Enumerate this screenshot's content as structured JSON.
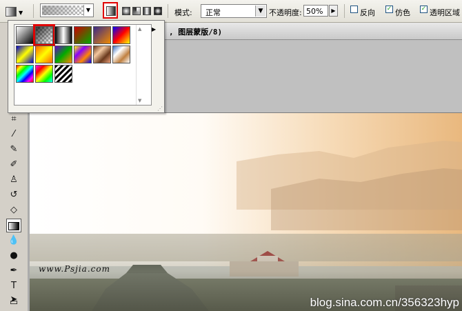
{
  "options_bar": {
    "mode_label": "模式:",
    "mode_value": "正常",
    "opacity_label": "不透明度:",
    "opacity_value": "50%",
    "reverse_label": "反向",
    "reverse_checked": false,
    "dither_label": "仿色",
    "dither_checked": true,
    "transparency_label": "透明区域",
    "transparency_checked": true,
    "gradient_types": [
      "linear-gradient-icon",
      "radial-gradient-icon",
      "angle-gradient-icon",
      "reflected-gradient-icon",
      "diamond-gradient-icon"
    ],
    "selected_gradient_type": "linear-gradient-icon"
  },
  "document": {
    "title_suffix": ", 图层蒙版/8)"
  },
  "watermarks": {
    "site": "www.Psjia.com",
    "blog": "blog.sina.com.cn/356323hyp"
  },
  "gradient_presets": [
    {
      "name": "foreground-to-background",
      "css": "linear-gradient(135deg,#fff,#000)"
    },
    {
      "name": "foreground-to-transparent",
      "css": "checker"
    },
    {
      "name": "black-white",
      "css": "linear-gradient(90deg,#000,#fff,#000)"
    },
    {
      "name": "red-green",
      "css": "linear-gradient(135deg,#c00,#0a0)"
    },
    {
      "name": "violet-orange",
      "css": "linear-gradient(135deg,#3a2a8a,#f08a00)"
    },
    {
      "name": "blue-red-yellow",
      "css": "linear-gradient(135deg,#00f,#f00,#ff0)"
    },
    {
      "name": "blue-yellow-blue",
      "css": "linear-gradient(135deg,#00c,#ff0,#00c)"
    },
    {
      "name": "orange-yellow-orange",
      "css": "linear-gradient(135deg,#f60,#ff0,#f60)"
    },
    {
      "name": "violet-green-orange",
      "css": "linear-gradient(135deg,#60c,#0a0,#f80)"
    },
    {
      "name": "yellow-violet-orange-blue",
      "css": "linear-gradient(135deg,#ff0,#80f,#f80,#00f)"
    },
    {
      "name": "copper",
      "css": "linear-gradient(135deg,#6b3a1e,#f4c9a0,#6b3a1e,#e9a07a)"
    },
    {
      "name": "chrome",
      "css": "linear-gradient(135deg,#3b6fc0,#fff,#c08040,#fff)"
    },
    {
      "name": "spectrum",
      "css": "linear-gradient(135deg,#f00,#ff0,#0f0,#0ff,#00f,#f0f,#f00)"
    },
    {
      "name": "transparent-rainbow",
      "css": "linear-gradient(135deg,#f0f,#f00,#ff0,#0f0,#0ff)"
    },
    {
      "name": "transparent-stripes",
      "css": "stripes"
    }
  ],
  "selected_preset_index": 1
}
